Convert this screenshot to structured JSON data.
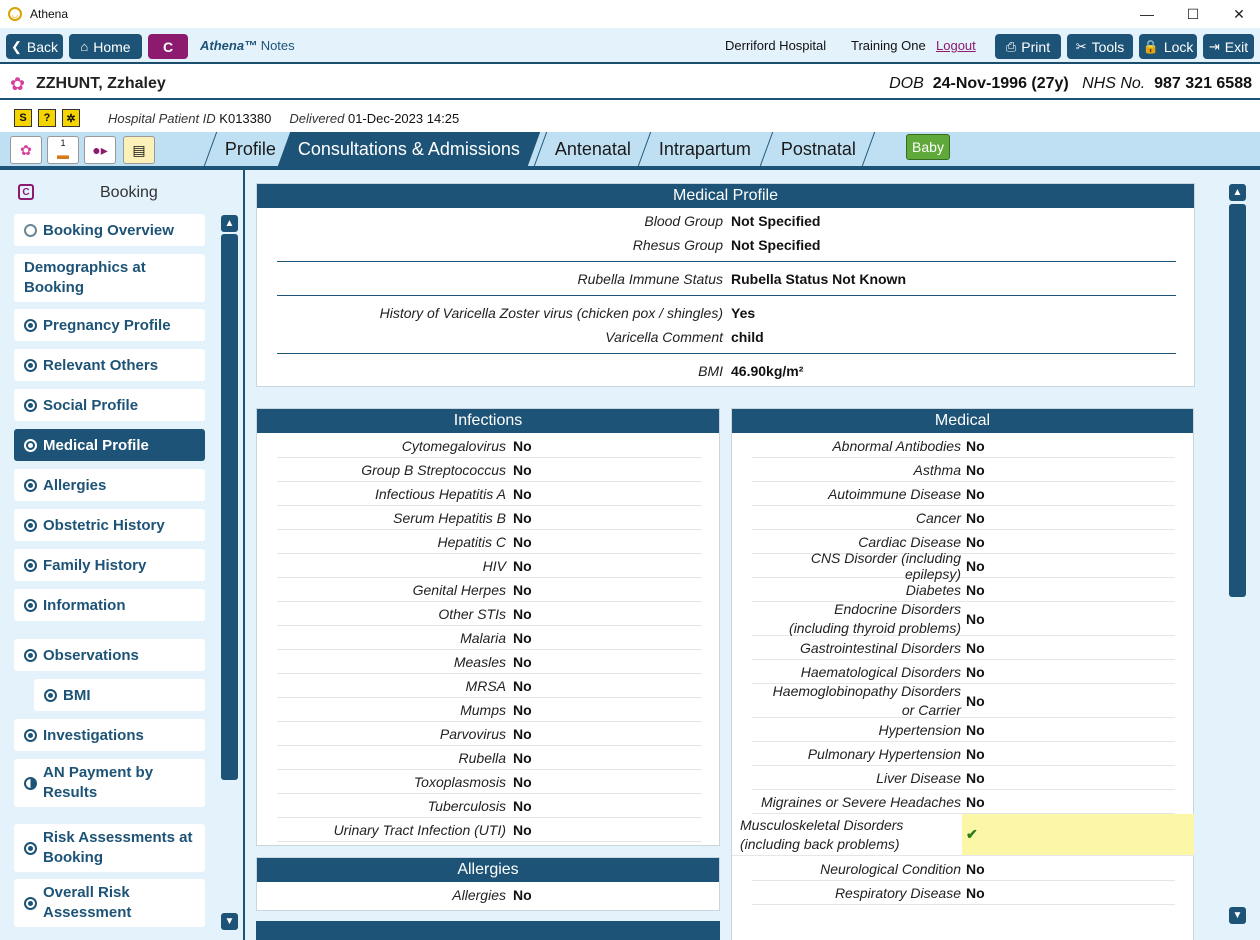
{
  "window": {
    "title": "Athena",
    "controls": [
      "—",
      "☐",
      "✕"
    ]
  },
  "toolbar": {
    "back": "Back",
    "home": "Home",
    "c": "C",
    "brand": "Athena™",
    "notes": "Notes",
    "hospital": "Derriford Hospital",
    "user": "Training One",
    "logout": "Logout",
    "print": "Print",
    "tools": "Tools",
    "lock": "Lock",
    "exit": "Exit"
  },
  "patient": {
    "name": "ZZHUNT, Zzhaley",
    "dob_label": "DOB",
    "dob": "24-Nov-1996 (27y)",
    "nhs_label": "NHS No.",
    "nhs": "987 321 6588",
    "hpid_label": "Hospital Patient ID",
    "hpid": "K013380",
    "delivered_label": "Delivered",
    "delivered": "01-Dec-2023 14:25",
    "flags": [
      "S",
      "?",
      "✲"
    ]
  },
  "tabs": {
    "items": [
      "Profile",
      "Consultations & Admissions",
      "Antenatal",
      "Intrapartum",
      "Postnatal"
    ],
    "active": "Consultations & Admissions",
    "baby": "Baby",
    "tool_badge": "1"
  },
  "sidebar": {
    "header": "Booking",
    "items": [
      {
        "label": "Booking Overview",
        "state": "open"
      },
      {
        "label": "Demographics at Booking",
        "state": "none"
      },
      {
        "label": "Pregnancy Profile",
        "state": "filled"
      },
      {
        "label": "Relevant Others",
        "state": "filled"
      },
      {
        "label": "Social Profile",
        "state": "filled"
      },
      {
        "label": "Medical Profile",
        "state": "filled",
        "active": true
      },
      {
        "label": "Allergies",
        "state": "filled"
      },
      {
        "label": "Obstetric History",
        "state": "filled"
      },
      {
        "label": "Family History",
        "state": "filled"
      },
      {
        "label": "Information",
        "state": "filled"
      },
      {
        "label": "Observations",
        "state": "filled"
      },
      {
        "label": "BMI",
        "state": "filled"
      },
      {
        "label": "Investigations",
        "state": "filled"
      },
      {
        "label": "AN Payment by Results",
        "state": "half"
      },
      {
        "label": "Risk Assessments at Booking",
        "state": "filled"
      },
      {
        "label": "Overall Risk Assessment",
        "state": "filled"
      }
    ]
  },
  "medical_profile": {
    "title": "Medical Profile",
    "rows": [
      {
        "label": "Blood Group",
        "value": "Not Specified"
      },
      {
        "label": "Rhesus Group",
        "value": "Not Specified"
      },
      {
        "label": "Rubella Immune Status",
        "value": "Rubella Status Not Known"
      },
      {
        "label": "History of Varicella Zoster virus (chicken pox / shingles)",
        "value": "Yes"
      },
      {
        "label": "Varicella Comment",
        "value": "child"
      },
      {
        "label": "BMI",
        "value": "46.90kg/m²"
      }
    ]
  },
  "infections": {
    "title": "Infections",
    "rows": [
      {
        "label": "Cytomegalovirus",
        "value": "No"
      },
      {
        "label": "Group B Streptococcus",
        "value": "No"
      },
      {
        "label": "Infectious Hepatitis A",
        "value": "No"
      },
      {
        "label": "Serum Hepatitis B",
        "value": "No"
      },
      {
        "label": "Hepatitis C",
        "value": "No"
      },
      {
        "label": "HIV",
        "value": "No"
      },
      {
        "label": "Genital Herpes",
        "value": "No"
      },
      {
        "label": "Other STIs",
        "value": "No"
      },
      {
        "label": "Malaria",
        "value": "No"
      },
      {
        "label": "Measles",
        "value": "No"
      },
      {
        "label": "MRSA",
        "value": "No"
      },
      {
        "label": "Mumps",
        "value": "No"
      },
      {
        "label": "Parvovirus",
        "value": "No"
      },
      {
        "label": "Rubella",
        "value": "No"
      },
      {
        "label": "Toxoplasmosis",
        "value": "No"
      },
      {
        "label": "Tuberculosis",
        "value": "No"
      },
      {
        "label": "Urinary Tract Infection (UTI)",
        "value": "No"
      }
    ]
  },
  "allergies": {
    "title": "Allergies",
    "rows": [
      {
        "label": "Allergies",
        "value": "No"
      }
    ]
  },
  "medical": {
    "title": "Medical",
    "rows": [
      {
        "label": "Abnormal Antibodies",
        "value": "No"
      },
      {
        "label": "Asthma",
        "value": "No"
      },
      {
        "label": "Autoimmune Disease",
        "value": "No"
      },
      {
        "label": "Cancer",
        "value": "No"
      },
      {
        "label": "Cardiac Disease",
        "value": "No"
      },
      {
        "label": "CNS Disorder (including epilepsy)",
        "value": "No"
      },
      {
        "label": "Diabetes",
        "value": "No"
      },
      {
        "label": "Endocrine Disorders (including thyroid problems)",
        "value": "No"
      },
      {
        "label": "Gastrointestinal Disorders",
        "value": "No"
      },
      {
        "label": "Haematological Disorders",
        "value": "No"
      },
      {
        "label": "Haemoglobinopathy Disorders or Carrier",
        "value": "No"
      },
      {
        "label": "Hypertension",
        "value": "No"
      },
      {
        "label": "Pulmonary Hypertension",
        "value": "No"
      },
      {
        "label": "Liver Disease",
        "value": "No"
      },
      {
        "label": "Migraines or Severe Headaches",
        "value": "No"
      },
      {
        "label": "Musculoskeletal Disorders (including back problems)",
        "value": "✔",
        "highlight": true
      },
      {
        "label": "Neurological Condition",
        "value": "No"
      },
      {
        "label": "Respiratory Disease",
        "value": "No"
      }
    ]
  },
  "colors": {
    "primary": "#1d5376",
    "accent": "#8c1a6e",
    "background": "#e3f2fb",
    "highlight": "#fbf7a6",
    "baby": "#5fa83a"
  }
}
